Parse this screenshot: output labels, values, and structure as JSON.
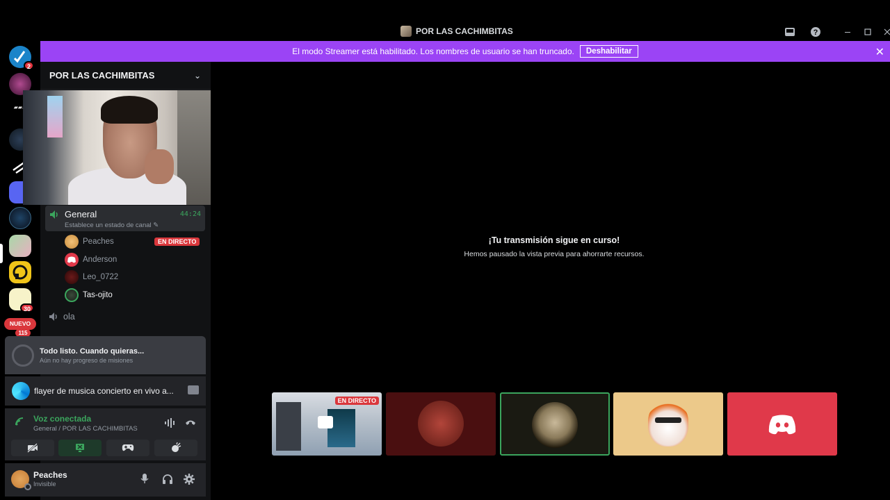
{
  "window": {
    "title": "POR LAS CACHIMBITAS"
  },
  "banner": {
    "message": "El modo Streamer está habilitado. Los nombres de usuario se han truncado.",
    "button": "Deshabilitar"
  },
  "rail": {
    "badges": [
      "2",
      "30",
      "115"
    ],
    "new_label": "NUEVO"
  },
  "sidebar": {
    "guild_name": "POR LAS CACHIMBITAS",
    "voice_channel": {
      "name": "General",
      "status": "Establece un estado de canal",
      "timer": "44:24"
    },
    "members": [
      {
        "name": "Peaches",
        "live": "EN DIRECTO"
      },
      {
        "name": "Anderson"
      },
      {
        "name": "Leo_0722"
      },
      {
        "name": "Tas-ojito"
      }
    ],
    "text_channel": "ola"
  },
  "quest": {
    "title": "Todo listo. Cuando quieras...",
    "subtitle": "Aún no hay progreso de misiones"
  },
  "activity": {
    "text": "flayer de musica concierto en vivo a..."
  },
  "voice": {
    "status": "Voz conectada",
    "location": "General / POR LAS CACHIMBITAS"
  },
  "user": {
    "name": "Peaches",
    "status": "Invisible"
  },
  "stage": {
    "headline": "¡Tu transmisión sigue en curso!",
    "subline": "Hemos pausado la vista previa para ahorrarte recursos.",
    "tile_live_label": "EN DIRECTO"
  },
  "colors": {
    "banner": "#9b44f5",
    "voice_green": "#3ba55d",
    "live_red": "#da373c",
    "discord_red": "#e0394a"
  }
}
